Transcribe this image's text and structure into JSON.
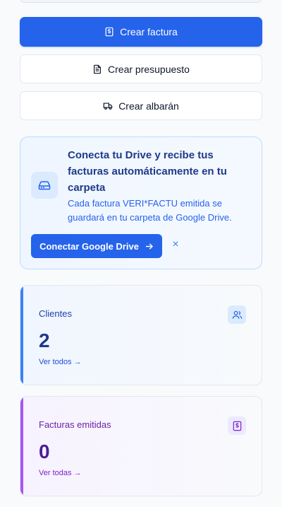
{
  "actions": {
    "create_invoice": "Crear factura",
    "create_quote": "Crear presupuesto",
    "create_delivery_note": "Crear albarán"
  },
  "drive_banner": {
    "title": "Conecta tu Drive y recibe tus facturas automáticamente en tu carpeta",
    "description": "Cada factura VERI*FACTU emitida se guardará en tu carpeta de Google Drive.",
    "connect_label": "Conectar Google Drive",
    "close_label": "×",
    "icon": "hard-drive-icon"
  },
  "stats": {
    "clients": {
      "label": "Clientes",
      "value": "2",
      "link": "Ver todos →",
      "icon": "users-icon",
      "accent": "#3b82f6"
    },
    "invoices": {
      "label": "Facturas emitidas",
      "value": "0",
      "link": "Ver todas →",
      "icon": "receipt-dollar-icon",
      "accent": "#a855f7"
    }
  },
  "colors": {
    "primary": "#2563eb",
    "background": "#f8fafc"
  }
}
